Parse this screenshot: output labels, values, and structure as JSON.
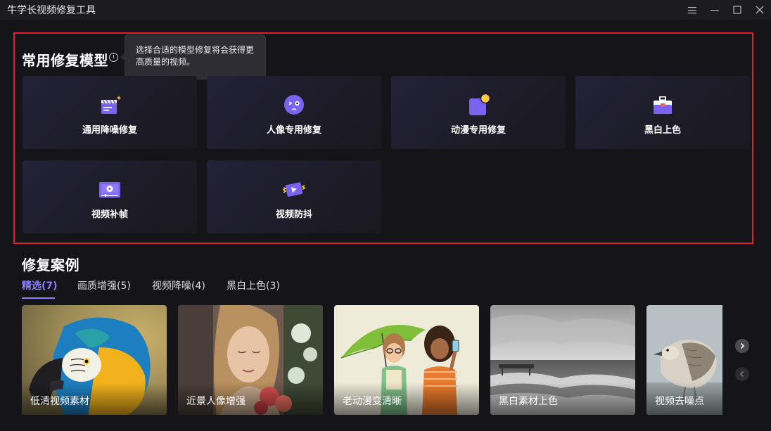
{
  "window": {
    "title": "牛学长视频修复工具",
    "controls": [
      "menu-icon",
      "minimize-icon",
      "maximize-icon",
      "close-icon"
    ]
  },
  "models_section": {
    "title": "常用修复模型",
    "tooltip": "选择合适的模型修复将会获得更高质量的视频。",
    "highlight_color": "#e0212b",
    "cards": [
      {
        "label": "通用降噪修复",
        "icon": "clapperboard-icon"
      },
      {
        "label": "人像专用修复",
        "icon": "face-icon"
      },
      {
        "label": "动漫专用修复",
        "icon": "anime-icon"
      },
      {
        "label": "黑白上色",
        "icon": "paint-bucket-icon"
      },
      {
        "label": "视频补帧",
        "icon": "video-frame-icon"
      },
      {
        "label": "视频防抖",
        "icon": "stabilize-icon"
      }
    ]
  },
  "cases_section": {
    "title": "修复案例",
    "accent_color": "#8a7dff",
    "tabs": [
      {
        "label": "精选(7)",
        "active": true
      },
      {
        "label": "画质增强(5)",
        "active": false
      },
      {
        "label": "视频降噪(4)",
        "active": false
      },
      {
        "label": "黑白上色(3)",
        "active": false
      }
    ],
    "items": [
      {
        "caption": "低清视频素材",
        "image": "parrot"
      },
      {
        "caption": "近景人像增强",
        "image": "woman-portrait"
      },
      {
        "caption": "老动漫变清晰",
        "image": "cartoon-girls-umbrella"
      },
      {
        "caption": "黑白素材上色",
        "image": "black-white-sea"
      },
      {
        "caption": "视频去噪点",
        "image": "seagull"
      }
    ],
    "nav": [
      "chevron-right-icon",
      "chevron-left-icon"
    ]
  }
}
